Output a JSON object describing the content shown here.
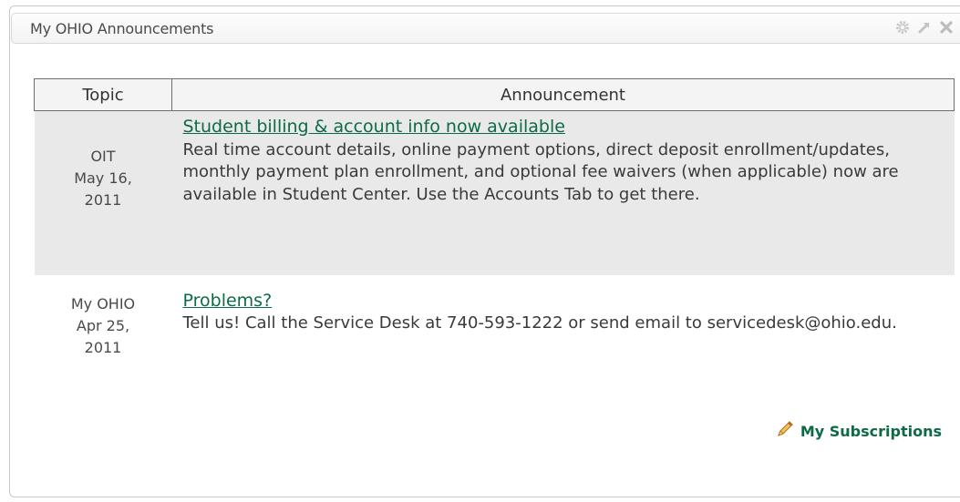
{
  "portlet": {
    "title": "My OHIO Announcements",
    "icons": [
      "gear-icon",
      "pin-icon",
      "close-icon"
    ]
  },
  "table": {
    "headers": {
      "topic": "Topic",
      "announcement": "Announcement"
    },
    "rows": [
      {
        "topic": "OIT",
        "date_line1": "May 16,",
        "date_line2": "2011",
        "link": "Student billing & account info now available",
        "body": "Real time account details, online payment options, direct deposit enrollment/updates, monthly payment plan enrollment, and optional fee waivers (when applicable) now are available in Student Center. Use the Accounts Tab to get there."
      },
      {
        "topic": "My OHIO",
        "date_line1": "Apr 25,",
        "date_line2": "2011",
        "link": "Problems?",
        "body": "Tell us! Call the Service Desk at 740-593-1222 or send email to servicedesk@ohio.edu."
      }
    ]
  },
  "footer": {
    "subscriptions_label": "My Subscriptions"
  },
  "colors": {
    "link": "#0c6b45",
    "row_shade": "#e9e9e9",
    "header_border": "#6f6f6f"
  }
}
